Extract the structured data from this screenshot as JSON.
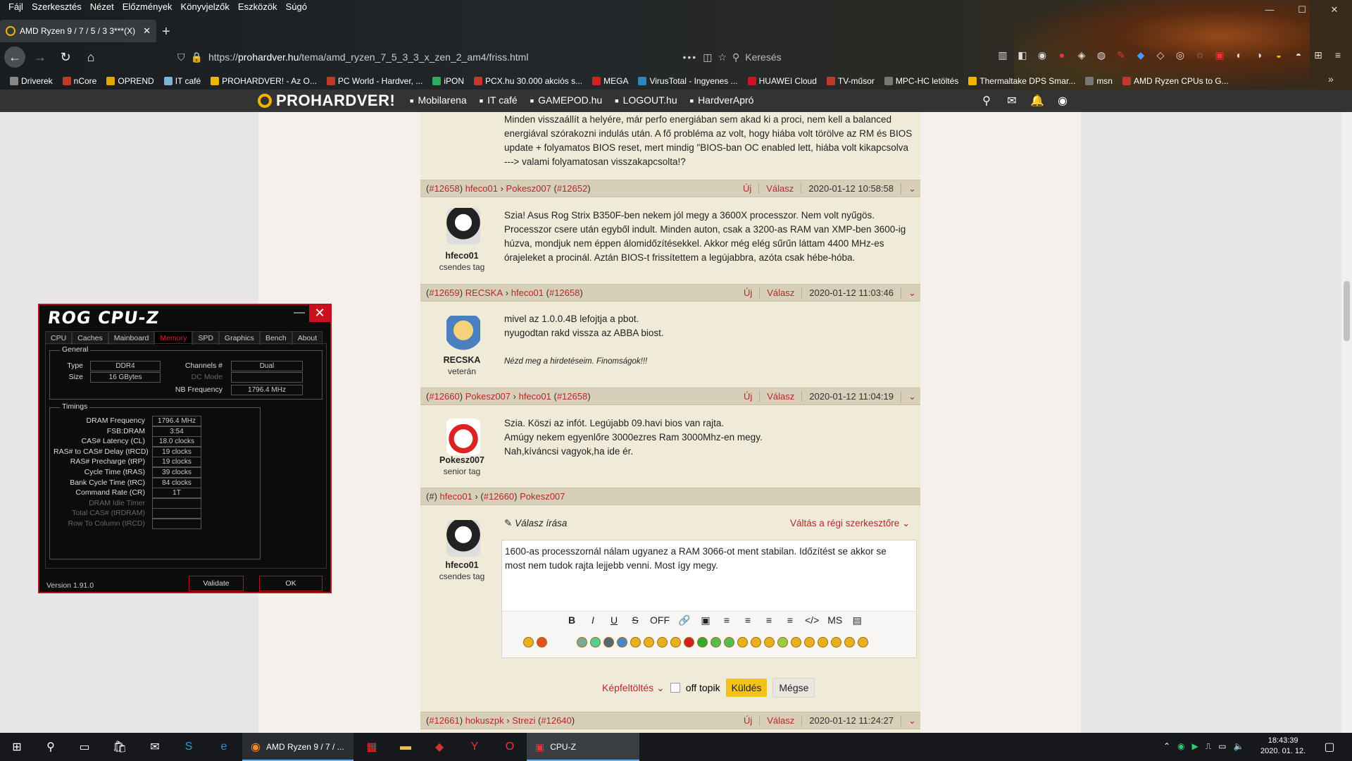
{
  "browser": {
    "menu": [
      "Fájl",
      "Szerkesztés",
      "Nézet",
      "Előzmények",
      "Könyvjelzők",
      "Eszközök",
      "Súgó"
    ],
    "tab_title": "AMD Ryzen 9 / 7 / 5 / 3 3***(X)",
    "url_prefix": "https://",
    "url_host": "prohardver.hu",
    "url_path": "/tema/amd_ryzen_7_5_3_3_x_zen_2_am4/friss.html",
    "search_placeholder": "Keresés",
    "bookmarks": [
      {
        "label": "Driverek",
        "color": "#888"
      },
      {
        "label": "nCore",
        "color": "#c0392b"
      },
      {
        "label": "OPREND",
        "color": "#e0a800"
      },
      {
        "label": "IT café",
        "color": "#7fb3d5"
      },
      {
        "label": "PROHARDVER! - Az O...",
        "color": "#f0b400"
      },
      {
        "label": "PC World - Hardver, ...",
        "color": "#c0392b"
      },
      {
        "label": "iPON",
        "color": "#27ae60"
      },
      {
        "label": "PCX.hu 30.000 akciós s...",
        "color": "#c0392b"
      },
      {
        "label": "MEGA",
        "color": "#d61f26"
      },
      {
        "label": "VirusTotal - Ingyenes ...",
        "color": "#2e86c1"
      },
      {
        "label": "HUAWEI Cloud",
        "color": "#cf1322"
      },
      {
        "label": "TV-műsor",
        "color": "#c0392b"
      },
      {
        "label": "MPC-HC letöltés",
        "color": "#777"
      },
      {
        "label": "Thermaltake DPS Smar...",
        "color": "#f0b400"
      },
      {
        "label": "msn",
        "color": "#777"
      },
      {
        "label": "AMD Ryzen CPUs to G...",
        "color": "#c0392b"
      }
    ]
  },
  "site": {
    "logo": "PROHARDVER!",
    "links": [
      "Mobilarena",
      "IT café",
      "GAMEPOD.hu",
      "LOGOUT.hu",
      "HardverApró"
    ]
  },
  "posts": {
    "p0_text": "Minden visszaállít a helyére, már perfo energiában sem akad ki a proci, nem kell a balanced energiával szórakozni indulás után. A fő probléma az volt, hogy hiába volt törölve az RM és BIOS update + folyamatos BIOS reset, mert mindig \"BIOS-ban OC enabled lett, hiába volt kikapcsolva ---> valami folyamatosan visszakapcsolta!?",
    "h1": {
      "id": "#12658",
      "author": "hfeco01",
      "to": "Pokesz007",
      "ref": "#12652",
      "new": "Új",
      "reply": "Válasz",
      "date": "2020-01-12 10:58:58"
    },
    "p1": {
      "user": "hfeco01",
      "rank": "csendes tag",
      "text": "Szia! Asus Rog Strix B350F-ben nekem jól megy a 3600X processzor. Nem volt nyűgös. Processzor csere után egyből indult. Minden auton, csak a 3200-as RAM van XMP-ben 3600-ig húzva, mondjuk nem éppen álomidőzítésekkel. Akkor még elég sűrűn láttam 4400 MHz-es órajeleket a procinál. Aztán BIOS-t frissítettem a legújabbra, azóta csak hébe-hóba."
    },
    "h2": {
      "id": "#12659",
      "author": "RECSKA",
      "to": "hfeco01",
      "ref": "#12658",
      "new": "Új",
      "reply": "Válasz",
      "date": "2020-01-12 11:03:46"
    },
    "p2": {
      "user": "RECSKA",
      "rank": "veterán",
      "line1": "mivel az 1.0.0.4B lefojtja a pbot.",
      "line2": "nyugodtan rakd vissza az ABBA biost.",
      "sig": "Nézd meg a hirdetéseim. Finomságok!!!"
    },
    "h3": {
      "id": "#12660",
      "author": "Pokesz007",
      "to": "hfeco01",
      "ref": "#12658",
      "new": "Új",
      "reply": "Válasz",
      "date": "2020-01-12 11:04:19"
    },
    "p3": {
      "user": "Pokesz007",
      "rank": "senior tag",
      "line1": "Szia. Köszi az infót. Legújabb 09.havi bios van rajta.",
      "line2": "Amúgy nekem egyenlőre 3000ezres Ram 3000Mhz-en megy.",
      "line3": "Nah,kíváncsi vagyok,ha ide ér."
    },
    "h4": {
      "id": "#",
      "author": "hfeco01",
      "ref": "#12660",
      "to": "Pokesz007"
    },
    "reply_box": {
      "user": "hfeco01",
      "rank": "csendes tag",
      "title": "Válasz írása",
      "switch": "Váltás a régi szerkesztőre",
      "text": "1600-as processzornál nálam ugyanez a RAM 3066-ot ment stabilan. Időzítést se akkor se most nem tudok rajta lejjebb venni. Most így megy.",
      "fmt": [
        "B",
        "I",
        "U",
        "S",
        "OFF",
        "🔗",
        "▣",
        "≡",
        "≡",
        "≡",
        "≡",
        "</>",
        "MS",
        "▤"
      ],
      "upload": "Képfeltöltés",
      "offtopic": "off topik",
      "send": "Küldés",
      "cancel": "Mégse"
    },
    "h5": {
      "id": "#12661",
      "author": "hokuszpk",
      "to": "Strezi",
      "ref": "#12640",
      "new": "Új",
      "reply": "Válasz",
      "date": "2020-01-12 11:24:27"
    }
  },
  "cpuz": {
    "title": "ROG CPU-Z",
    "tabs": [
      "CPU",
      "Caches",
      "Mainboard",
      "Memory",
      "SPD",
      "Graphics",
      "Bench",
      "About"
    ],
    "active_tab": "Memory",
    "general_label": "General",
    "type_label": "Type",
    "type_val": "DDR4",
    "size_label": "Size",
    "size_val": "16 GBytes",
    "channels_label": "Channels #",
    "channels_val": "Dual",
    "dcmode_label": "DC Mode",
    "nbfreq_label": "NB Frequency",
    "nbfreq_val": "1796.4 MHz",
    "timings_label": "Timings",
    "timings": [
      {
        "label": "DRAM Frequency",
        "val": "1796.4 MHz"
      },
      {
        "label": "FSB:DRAM",
        "val": "3:54"
      },
      {
        "label": "CAS# Latency (CL)",
        "val": "18.0 clocks"
      },
      {
        "label": "RAS# to CAS# Delay (tRCD)",
        "val": "19 clocks"
      },
      {
        "label": "RAS# Precharge (tRP)",
        "val": "19 clocks"
      },
      {
        "label": "Cycle Time (tRAS)",
        "val": "39 clocks"
      },
      {
        "label": "Bank Cycle Time (tRC)",
        "val": "84 clocks"
      },
      {
        "label": "Command Rate (CR)",
        "val": "1T"
      },
      {
        "label": "DRAM Idle Timer",
        "val": ""
      },
      {
        "label": "Total CAS# (tRDRAM)",
        "val": ""
      },
      {
        "label": "Row To Column (tRCD)",
        "val": ""
      }
    ],
    "version": "Version 1.91.0",
    "validate": "Validate",
    "ok": "OK"
  },
  "taskbar": {
    "firefox_label": "AMD Ryzen 9 / 7 / ...",
    "cpuz_label": "CPU-Z",
    "time": "18:43:39",
    "date": "2020. 01. 12."
  }
}
